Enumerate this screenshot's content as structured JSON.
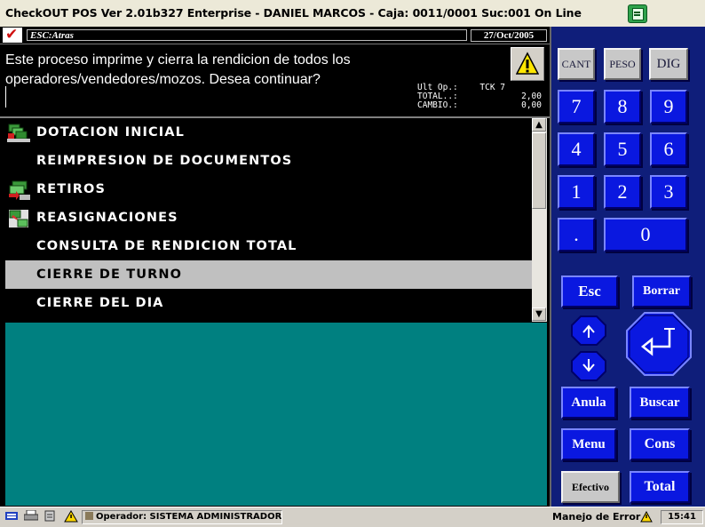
{
  "window": {
    "title": "CheckOUT POS Ver 2.01b327 Enterprise - DANIEL MARCOS - Caja: 0011/0001 Suc:001  On Line"
  },
  "header": {
    "esc_label": "ESC:Atras",
    "date": "27/Oct/2005"
  },
  "message": {
    "line1": "Este proceso imprime y cierra la rendicion de todos los",
    "line2": "operadores/vendedores/mozos. Desea continuar?"
  },
  "ticket_info": {
    "last_op_label": "Ult Op.:",
    "last_op_value": "TCK 7",
    "total_label": "TOTAL..:",
    "total_value": "2,00",
    "change_label": "CAMBIO.:",
    "change_value": "0,00"
  },
  "menu": {
    "items": [
      {
        "label": "DOTACION INICIAL",
        "icon": "money-stack-icon"
      },
      {
        "label": "REIMPRESION DE DOCUMENTOS",
        "icon": ""
      },
      {
        "label": "RETIROS",
        "icon": "money-withdraw-icon"
      },
      {
        "label": "REASIGNACIONES",
        "icon": "reassign-icon"
      },
      {
        "label": "CONSULTA DE RENDICION TOTAL",
        "icon": ""
      },
      {
        "label": "CIERRE DE TURNO",
        "icon": "",
        "selected": true
      },
      {
        "label": "CIERRE DEL DIA",
        "icon": ""
      }
    ]
  },
  "keypad": {
    "cant": "CANT",
    "peso": "PESO",
    "dig": "DIG",
    "n7": "7",
    "n8": "8",
    "n9": "9",
    "n4": "4",
    "n5": "5",
    "n6": "6",
    "n1": "1",
    "n2": "2",
    "n3": "3",
    "dot": ".",
    "n0": "0",
    "esc": "Esc",
    "borrar": "Borrar",
    "anula": "Anula",
    "buscar": "Buscar",
    "menu": "Menu",
    "cons": "Cons",
    "efectivo": "Efectivo",
    "total": "Total"
  },
  "status": {
    "operator": "Operador: SISTEMA ADMINISTRADOR",
    "error_mode": "Manejo de Error",
    "time": "15:41"
  },
  "colors": {
    "keypad_bg": "#0f1e7a",
    "key_blue": "#0a18e0",
    "teal": "#008080",
    "selected_row": "#c0c0c0"
  }
}
